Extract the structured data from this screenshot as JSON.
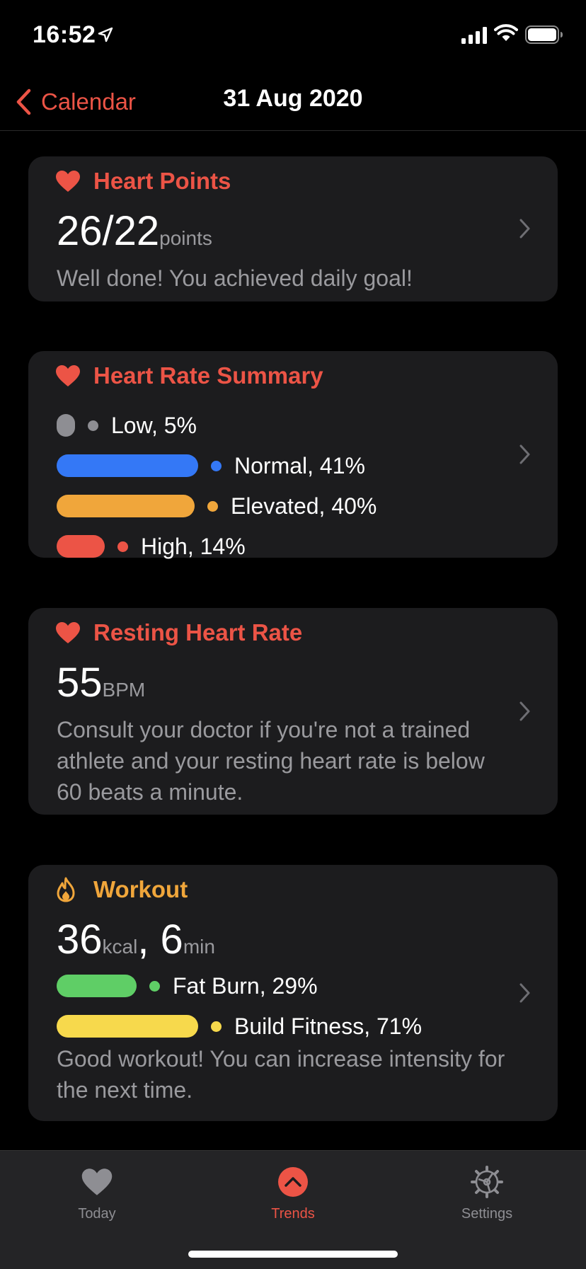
{
  "status_bar": {
    "time": "16:52"
  },
  "nav": {
    "back_label": "Calendar",
    "title": "31 Aug 2020"
  },
  "heart_points": {
    "title": "Heart Points",
    "value": "26/22",
    "unit": "points",
    "message": "Well done! You achieved daily goal!"
  },
  "heart_rate_summary": {
    "title": "Heart Rate Summary",
    "zones": [
      {
        "label": "Low, 5%",
        "percent": 5,
        "color": "#8e8e93"
      },
      {
        "label": "Normal, 41%",
        "percent": 41,
        "color": "#3478f6"
      },
      {
        "label": "Elevated, 40%",
        "percent": 40,
        "color": "#f0a63b"
      },
      {
        "label": "High, 14%",
        "percent": 14,
        "color": "#ec5446"
      }
    ]
  },
  "resting_heart_rate": {
    "title": "Resting Heart Rate",
    "value": "55",
    "unit": "BPM",
    "message": "Consult your doctor if you're not a trained athlete and your resting heart rate is below 60 beats a minute."
  },
  "workout": {
    "title": "Workout",
    "kcal_value": "36",
    "kcal_unit": "kcal",
    "separator": ", ",
    "min_value": "6",
    "min_unit": "min",
    "zones": [
      {
        "label": "Fat Burn, 29%",
        "percent": 29,
        "color": "#5fce66"
      },
      {
        "label": "Build Fitness, 71%",
        "percent": 71,
        "color": "#f7d94c"
      }
    ],
    "message": "Good workout! You can increase intensity for the next time."
  },
  "tab_bar": {
    "tabs": [
      {
        "label": "Today",
        "icon": "heart-icon",
        "active": false
      },
      {
        "label": "Trends",
        "icon": "trends-icon",
        "active": true
      },
      {
        "label": "Settings",
        "icon": "gear-icon",
        "active": false
      }
    ]
  },
  "colors": {
    "accent": "#ec5446",
    "workout": "#f0a63b",
    "card": "#1c1c1e",
    "secondary_text": "#9a9a9e"
  }
}
